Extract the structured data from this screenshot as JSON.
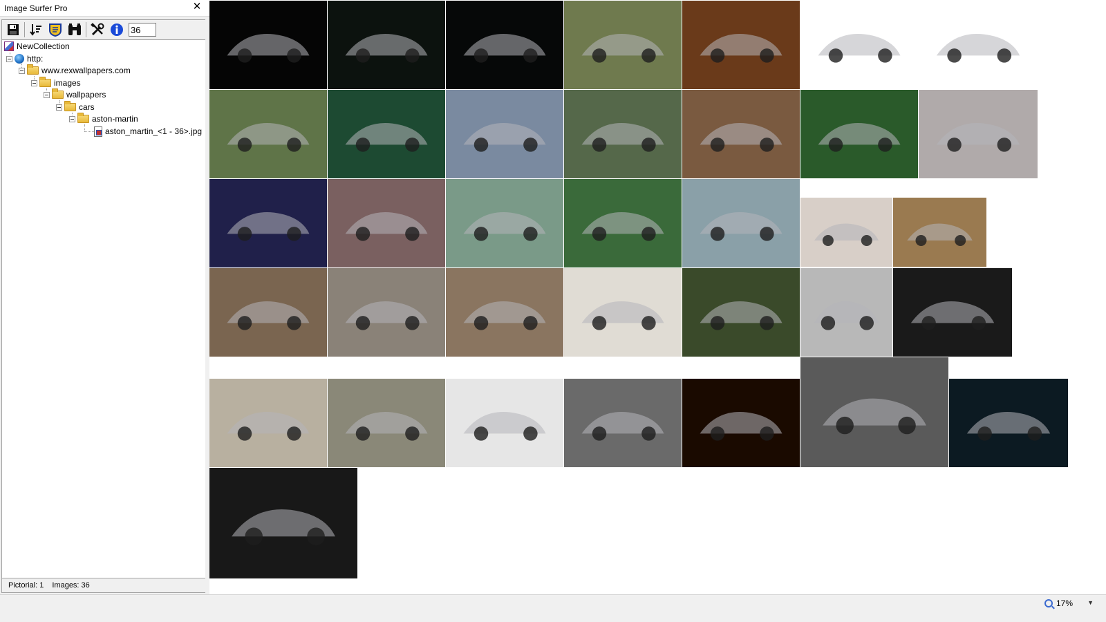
{
  "window": {
    "title": "Image Surfer Pro",
    "close": "✕"
  },
  "toolbar": {
    "count_value": "36"
  },
  "tree": {
    "collection": "NewCollection",
    "protocol": "http:",
    "domain": "www.rexwallpapers.com",
    "folder_images": "images",
    "folder_wallpapers": "wallpapers",
    "folder_cars": "cars",
    "folder_make": "aston-martin",
    "file_pattern": "aston_martin_<1 - 36>.jpg"
  },
  "status": {
    "pictorial": "Pictorial: 1",
    "images": "Images: 36"
  },
  "zoom": {
    "level": "17%",
    "arrow": "▼"
  },
  "thumbnails": [
    {
      "bg": "#050505"
    },
    {
      "bg": "#0c120e"
    },
    {
      "bg": "#060808"
    },
    {
      "bg": "#6f7a4e"
    },
    {
      "bg": "#6a3a1a"
    },
    {
      "bg": "#ffffff"
    },
    {
      "bg": "#ffffff"
    },
    {
      "bg": "#5f7448"
    },
    {
      "bg": "#1d4a32"
    },
    {
      "bg": "#7a8aa0"
    },
    {
      "bg": "#55684a"
    },
    {
      "bg": "#7a5a40"
    },
    {
      "bg": "#2a5a2a"
    },
    {
      "bg": "#b0aaaa"
    },
    {
      "bg": "#20204a"
    },
    {
      "bg": "#7a6060"
    },
    {
      "bg": "#7a9a88"
    },
    {
      "bg": "#3a6a3a"
    },
    {
      "bg": "#8aa0a8"
    },
    {
      "bg": "#d8cfc8"
    },
    {
      "bg": "#9a7a50"
    },
    {
      "bg": "#7a6550"
    },
    {
      "bg": "#8a8278"
    },
    {
      "bg": "#8a7560"
    },
    {
      "bg": "#e0dcd4"
    },
    {
      "bg": "#3a4a2a"
    },
    {
      "bg": "#b8b8b8"
    },
    {
      "bg": "#1a1a1a"
    },
    {
      "bg": "#b8b0a0"
    },
    {
      "bg": "#8a8878"
    },
    {
      "bg": "#e6e6e6"
    },
    {
      "bg": "#6a6a6a"
    },
    {
      "bg": "#1a0a00"
    },
    {
      "bg": "#5a5a5a"
    },
    {
      "bg": "#0c1a22"
    },
    {
      "bg": "#181818"
    }
  ]
}
